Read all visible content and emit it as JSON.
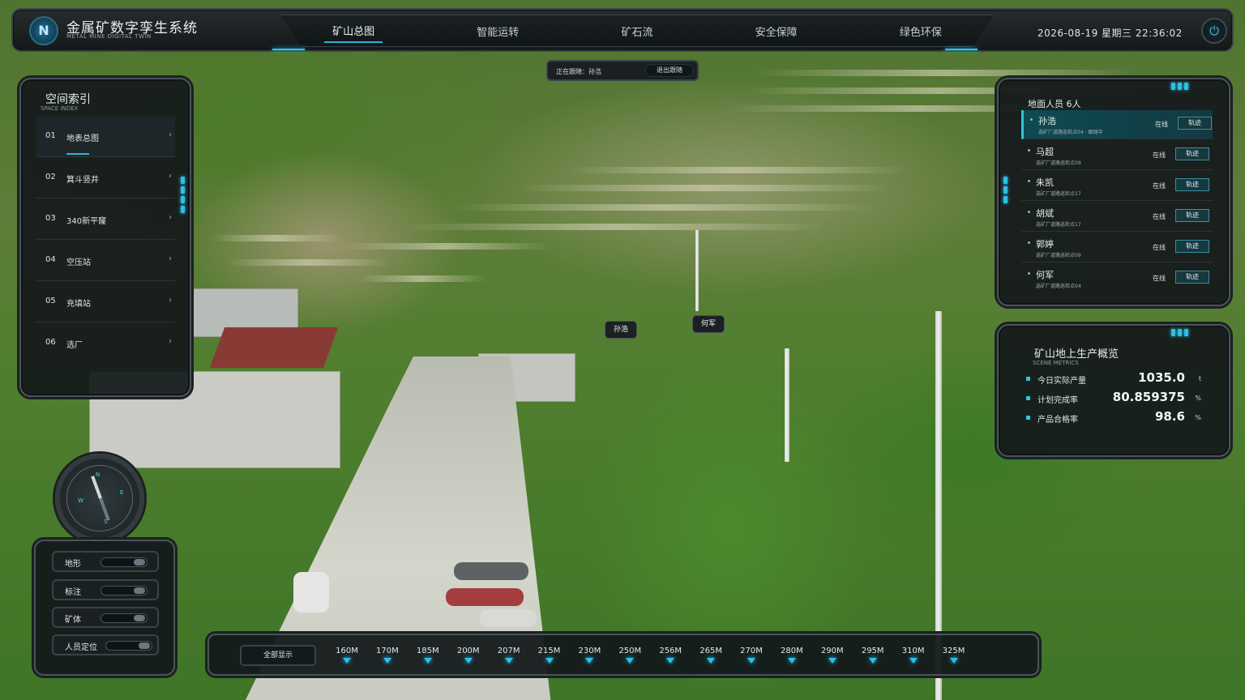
{
  "header": {
    "logo_letter": "N",
    "title": "金属矿数字孪生系统",
    "subtitle": "METAL MINE DIGITAL TWIN",
    "nav": [
      {
        "label": "矿山总图",
        "active": true
      },
      {
        "label": "智能运转",
        "active": false
      },
      {
        "label": "矿石流",
        "active": false
      },
      {
        "label": "安全保障",
        "active": false
      },
      {
        "label": "绿色环保",
        "active": false
      }
    ],
    "datetime": "2026-08-19  星期三  22:36:02",
    "power_icon": "power-icon"
  },
  "follow_bar": {
    "label": "正在跟随：孙浩",
    "exit_label": "退出跟随"
  },
  "space_index": {
    "title": "空间索引",
    "subtitle": "SPACE INDEX",
    "items": [
      {
        "num": "01",
        "name": "地表总图",
        "arrow": "›",
        "active": true
      },
      {
        "num": "02",
        "name": "箕斗竖井",
        "arrow": "›",
        "active": false
      },
      {
        "num": "03",
        "name": "340新平窿",
        "arrow": "›",
        "active": false
      },
      {
        "num": "04",
        "name": "空压站",
        "arrow": "›",
        "active": false
      },
      {
        "num": "05",
        "name": "充填站",
        "arrow": "›",
        "active": false
      },
      {
        "num": "06",
        "name": "选厂",
        "arrow": "›",
        "active": false
      }
    ]
  },
  "personnel": {
    "title": "地面人员  6人",
    "rows": [
      {
        "name": "孙浩",
        "location": "选矿厂道路巡检点04 · 跟随中",
        "status": "在线",
        "button": "轨迹",
        "active": true
      },
      {
        "name": "马超",
        "location": "选矿厂道路巡检点09",
        "status": "在线",
        "button": "轨迹",
        "active": false
      },
      {
        "name": "朱凯",
        "location": "选矿厂道路巡检点17",
        "status": "在线",
        "button": "轨迹",
        "active": false
      },
      {
        "name": "胡斌",
        "location": "选矿厂道路巡检点17",
        "status": "在线",
        "button": "轨迹",
        "active": false
      },
      {
        "name": "郭婷",
        "location": "选矿厂道路巡检点09",
        "status": "在线",
        "button": "轨迹",
        "active": false
      },
      {
        "name": "何军",
        "location": "选矿厂道路巡检点04",
        "status": "在线",
        "button": "轨迹",
        "active": false
      }
    ]
  },
  "production": {
    "title": "矿山地上生产概览",
    "subtitle": "SCENE METRICS",
    "metrics": [
      {
        "label": "今日实际产量",
        "value": "1035.0",
        "unit": "t"
      },
      {
        "label": "计划完成率",
        "value": "80.859375",
        "unit": "%"
      },
      {
        "label": "产品合格率",
        "value": "98.6",
        "unit": "%"
      }
    ]
  },
  "compass": {
    "n": "N",
    "e": "E",
    "w": "W",
    "s": "S"
  },
  "layers": [
    {
      "label": "地形",
      "on": false
    },
    {
      "label": "标注",
      "on": false
    },
    {
      "label": "矿体",
      "on": false
    },
    {
      "label": "人员定位",
      "on": true
    }
  ],
  "depth_bar": {
    "all_label": "全部显示",
    "levels": [
      "160M",
      "170M",
      "185M",
      "200M",
      "207M",
      "215M",
      "230M",
      "250M",
      "256M",
      "265M",
      "270M",
      "280M",
      "290M",
      "295M",
      "310M",
      "325M"
    ]
  },
  "scene_tags": [
    {
      "label": "孙浩"
    },
    {
      "label": "何军"
    }
  ],
  "colors": {
    "accent": "#26c6ec",
    "panel": "#14191b",
    "active_row": "#0f4a53"
  }
}
